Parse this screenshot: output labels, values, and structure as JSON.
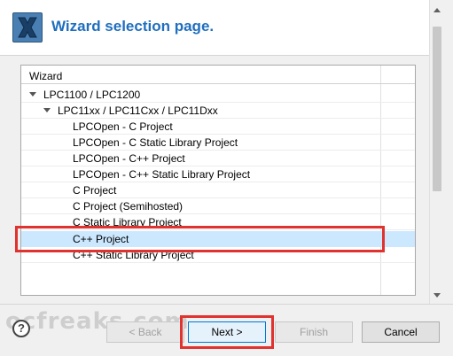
{
  "header": {
    "title": "Wizard selection page."
  },
  "tree": {
    "column_header": "Wizard",
    "rows": [
      {
        "label": "LPC1100 / LPC1200"
      },
      {
        "label": "LPC11xx / LPC11Cxx / LPC11Dxx"
      },
      {
        "label": "LPCOpen - C Project"
      },
      {
        "label": "LPCOpen - C Static Library Project"
      },
      {
        "label": "LPCOpen - C++ Project"
      },
      {
        "label": "LPCOpen - C++ Static Library Project"
      },
      {
        "label": "C Project"
      },
      {
        "label": "C Project (Semihosted)"
      },
      {
        "label": "C Static Library Project"
      },
      {
        "label": "C++ Project"
      },
      {
        "label": "C++ Static Library Project"
      }
    ],
    "selected_label": "C++ Project"
  },
  "buttons": {
    "back": "< Back",
    "next": "Next >",
    "finish": "Finish",
    "cancel": "Cancel",
    "help": "?"
  },
  "watermark": "ocfreaks.com",
  "colors": {
    "title": "#1f6fbf",
    "selection": "#cce8ff",
    "highlight": "#e0322e"
  },
  "icons": {
    "logo": "wizard-x-icon",
    "help": "help-icon"
  }
}
